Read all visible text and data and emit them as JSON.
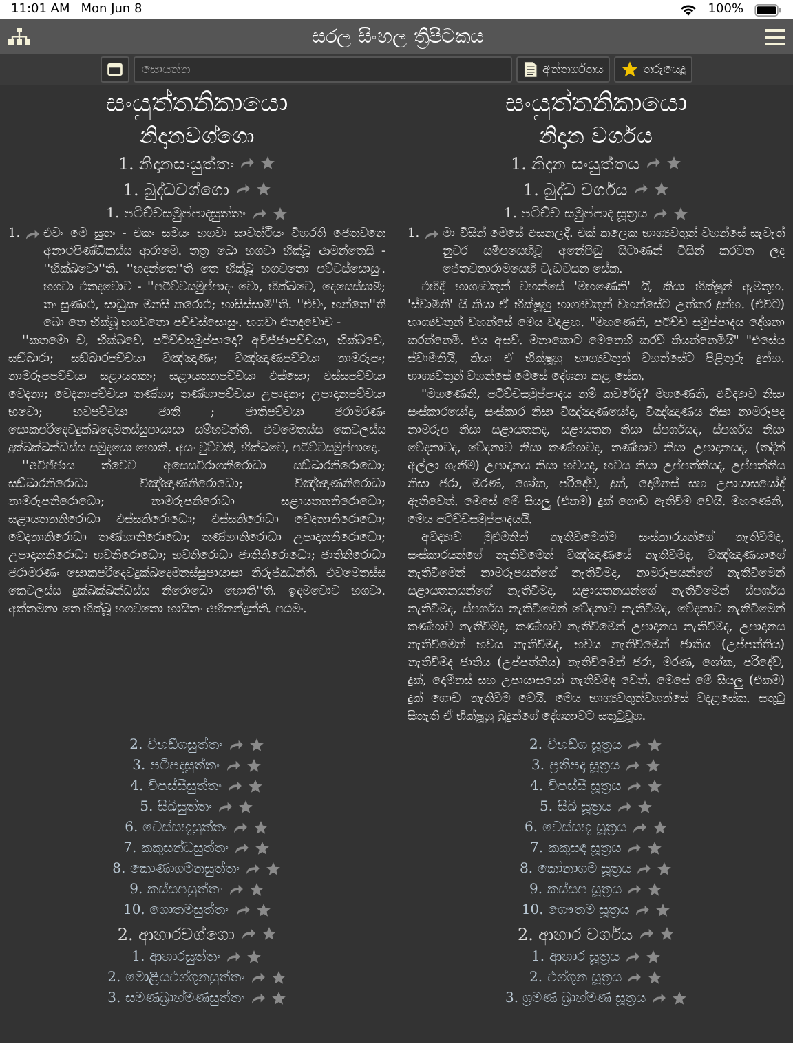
{
  "status_bar": {
    "time": "11:01 AM",
    "date": "Mon Jun 8",
    "battery": "100%"
  },
  "nav_bar": {
    "title": "සරල සිංහල ත්‍රිපිටකය"
  },
  "toolbar": {
    "search": {
      "placeholder": "සොයන්න"
    },
    "contents_button": "අන්තර්ගතය",
    "starred_button": "තරුයෙදූ"
  },
  "rows": [
    {
      "kind": "title",
      "left": "සංයුත්තනිකායො",
      "right": "සංයුත්තනිකායො"
    },
    {
      "kind": "subtitle",
      "left": "නිදානවග්ගො",
      "right": "නිදාන වර්ගය"
    },
    {
      "kind": "heading",
      "left": "1. නිදානසංයුත්තං",
      "right": "1. නිදාන සංයුත්තය"
    },
    {
      "kind": "heading",
      "left": "1. බුද්ධවග්ගො",
      "right": "1. බුද්ධ වර්ගය"
    },
    {
      "kind": "sutta",
      "left": "1. පටිච්චසමුප්පාදසුත්තං",
      "right": "1. පටිච්ච සමුප්පාද සූත්‍රය"
    },
    {
      "kind": "text",
      "left_number": "1.",
      "right_number": "1.",
      "left": [
        "එවං මෙ සුතං - එකං සමයං භගවා සාවත්ථියං විහරති ජෙතවනෙ අනාථපිණ්ඩිකස්ස ආරාමෙ. තත්‍ර ඛො භගවා භික්ඛූ ආමන්තෙසි - ''භික්ඛවො''ති. ''භදන්තෙ''ති තෙ භික්ඛූ භගවතො පච්චස්සොසුං. භගවා එතදවොච - ''පටිච්චසමුප්පාදං වො, භික්ඛවෙ, දෙසෙස්සාමි; තං සුණාථ, සාධුකං මනසි කරොථ; භාසිස්සාමී''ති. ''එවං, භන්තෙ''ති ඛො තෙ භික්ඛූ භගවතො පච්චස්සොසුං. භගවා එතදවොච -",
        "''කතමො ච, භික්ඛවෙ, පටිච්චසමුප්පාදො? අවිජ්ජාපච්චයා, භික්ඛවෙ, සඞ්ඛාරා; සඞ්ඛාරපච්චයා විඤ්ඤාණං; විඤ්ඤාණපච්චයා නාමරූපං; නාමරූපපච්චයා සළායතනං; සළායතනපච්චයා ඵස්සො; ඵස්සපච්චයා වෙදනා; වෙදනාපච්චයා තණ්හා; තණ්හාපච්චයා උපාදානං; උපාදානපච්චයා භවො; භවපච්චයා ජාති ; ජාතිපච්චයා ජරාමරණං සොකපරිදෙවදුක්ඛදොමනස්සුපායාසා සම්භවන්ති. එවමෙතස්ස කෙවලස්ස දුක්ඛක්ඛන්ධස්ස සමුදයො හොති. අයං වුච්චති, භික්ඛවෙ, පටිච්චසමුප්පාදො.",
        "''අවිජ්ජාය ත්වෙව අසෙසවිරාගනිරොධා සඞ්ඛාරනිරොධො; සඞ්ඛාරනිරොධා විඤ්ඤාණනිරොධො; විඤ්ඤාණනිරොධා නාමරූපනිරොධො; නාමරූපනිරොධා සළායතනනිරොධො; සළායතනනිරොධා ඵස්සනිරොධො; ඵස්සනිරොධා වෙදනානිරොධො; වෙදනානිරොධා තණ්හානිරොධො; තණ්හානිරොධා උපාදානනිරොධො; උපාදානනිරොධා භවනිරොධො; භවනිරොධා ජාතිනිරොධො; ජාතිනිරොධා ජරාමරණං සොකපරිදෙවදුක්ඛදොමනස්සුපායාසා නිරුජ්ඣන්ති. එවමෙතස්ස කෙවලස්ස දුක්ඛක්ඛන්ධස්ස නිරොධො හොතී''ති. ඉදමවොච භගවා. අත්තමනා තෙ භික්ඛූ භගවතො භාසිතං අභිනන්දුන්ති. පඨමං."
      ],
      "right": [
        "මා විසින් මෙසේ අසනලදී. එක් කලෙක භාග්‍යවතුන් වහන්සේ සැවැත් නුවර සමීපයෙහිවූ අනේපිඬු සිටාණන් විසින් කරවන ලද ජේතවනාරාමයෙහි වැඩවසන සේක.",
        "එහිදී භාග්‍යවතුන් වහන්සේ 'මහණෙනි' යි, කියා භික්ෂූන් ඇමතූහ. 'ස්වාමීනි' යි කියා ඒ භික්ෂූහු භාග්‍යවතුන් වහන්සේට උත්තර දුන්හ. (එවිට) භාග්‍යවතුන් වහන්සේ මෙය වදාළහ. \"මහණෙනි, පටිච්ච සමුප්පාදය දේශනා කරන්නෙමි. එය අසව්. මනාකොට මෙනෙහි කරව් කියන්නෙමියි\" \"එසේය ස්වාමීනියි, කියා ඒ භික්ෂූහු භාග්‍යවතුන් වහන්සේට පිළිතුරු දුන්හ. භාග්‍යවතුන් වහන්සේ මෙසේ දේශනා කළ සේක.",
        "\"මහණෙනි, පටිච්චසමුප්පාදය නම් කවරේද? මහණෙනි, අවිද්‍යාව නිසා සංස්කාරයෝද, සංස්කාර නිසා විඤ්ඤාණයෝද, විඤ්ඤාණය නිසා නාමරූපද නාමරූප නිසා සළායතනද, සළායතන නිසා ස්පර්ශයද, ස්පර්ශය නිසා වේදනාවද, වේදනාව නිසා තණ්හාවද, තණ්හාව නිසා උපාදානයද, (තදින් අල්ලා ගැනීම) උපාදානය නිසා භවයද, භවය නිසා උප්පත්තියද, උප්පත්තිය නිසා ජරා, මරණ, ශෝක, පරිදේව, දුක්, දොම්නස් සහ උපායාසයෝද් ඇතිවෙත්. මෙසේ මේ සියලු (එකම) දුක් ගොඩ ඇතිවීම වෙයි. මහණෙනි, මෙය පටිච්චසමුප්පාදයයි.",
        "අවිද්‍යාව මුළුමනින් නැතිවීමෙන්ම සංස්කාරයන්ගේ නැතිවීමද, සංස්කාරයන්ගේ නැතිවීමෙන් විඤ්ඤාණයේ නැතිවීමද, විඤ්ඤාණයාගේ නැතිවීමෙන් නාමරූපයන්ගේ නැතිවීමද, නාමරූපයන්ගේ නැතිවීමෙන් සළායතනයන්ගේ නැතිවීමද, සළායතනයන්ගේ නැතිවීමෙන් ස්පර්ශය නැතිවීමද, ස්පර්ශය නැතිවීමෙන් වේදනාව නැතිවීමද, වේදනාව නැතිවීමෙන් තණ්හාව නැතිවීමද, තණ්හාව නැතිවීමෙන් උපාදානය නැතිවීමද, උපාදානය නැතිවීමෙන් භවය නැතිවීමද, භවය නැතිවීමෙන් ජාතිය (උප්පත්තිය) නැතිවීමද ජාතිය (උප්පත්තිය) නැතිවීමෙන් ජරා, මරණ, ශෝක, පරිදේව, දුක්, දොම්නස් සහ උපායාසයෝ නැතිවීමද වෙත්. මෙසේ මේ සියලු (එකම) දුක් ගොඩ නැතිවීම වෙයි. මෙය භාග්‍යවතුන්වහන්සේ වදාළසේක. සතුටු සිතැති ඒ භික්ෂූහු බුදුන්ගේ දේශනාවට සතුටුවූහ."
      ]
    },
    {
      "kind": "link",
      "left": "2. විභඞ්ගසුත්තං",
      "right": "2. විභඞ්ග සූත්‍රය"
    },
    {
      "kind": "link",
      "left": "3. පටිපදාසුත්තං",
      "right": "3. ප්‍රතිපදා සූත්‍රය"
    },
    {
      "kind": "link",
      "left": "4. විපස්සීසුත්තං",
      "right": "4. විපස්සී සූත්‍රය"
    },
    {
      "kind": "link",
      "left": "5. සිඛීසුත්තං",
      "right": "5. සිඛී සූත්‍රය"
    },
    {
      "kind": "link",
      "left": "6. වෙස්සභූසුත්තං",
      "right": "6. වෙස්සභූ සූත්‍රය"
    },
    {
      "kind": "link",
      "left": "7. කකුසන්ධසුත්තං",
      "right": "7. කකුසඳ සූත්‍රය"
    },
    {
      "kind": "link",
      "left": "8. කොණාගමනසුත්තං",
      "right": "8. කෝනාගම සූත්‍රය"
    },
    {
      "kind": "link",
      "left": "9. කස්සපසුත්තං",
      "right": "9. කස්සප සූත්‍රය"
    },
    {
      "kind": "link",
      "left": "10. ගොතමසුත්තං",
      "right": "10. ගෞතම සූත්‍රය"
    },
    {
      "kind": "heading",
      "left": "2. ආහාරවග්ගො",
      "right": "2. ආහාර වර්ගය"
    },
    {
      "kind": "link",
      "left": "1. ආහාරසුත්තං",
      "right": "1. ආහාර සූත්‍රය"
    },
    {
      "kind": "link",
      "left": "2. මොළියඵග්ගුනසුත්තං",
      "right": "2. ඵග්ගුන සූත්‍රය"
    },
    {
      "kind": "link",
      "left": "3. සමණබ්‍රාහ්මණසුත්තං",
      "right": "3. ශ්‍රමණ බ්‍රාහ්මණ සූත්‍රය"
    }
  ]
}
